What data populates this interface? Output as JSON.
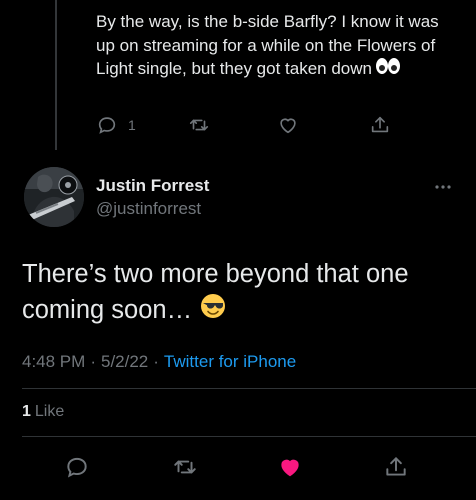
{
  "parent_tweet": {
    "text": "By the way, is the b-side Barfly? I know it was up on streaming for a while on the Flowers of Light single, but they got taken down",
    "trailing_emoji": "eyes-emoji",
    "actions": {
      "reply_icon": "reply-icon",
      "reply_count": "1",
      "retweet_icon": "retweet-icon",
      "like_icon": "heart-outline-icon",
      "share_icon": "share-icon"
    }
  },
  "tweet": {
    "author": {
      "display_name": "Justin Forrest",
      "handle": "@justinforrest",
      "avatar_icon": "avatar"
    },
    "more_icon": "more-options-icon",
    "text": "There’s two more beyond that one coming soon…",
    "trailing_emoji": "smiling-face-with-sunglasses-emoji",
    "time": "4:48 PM",
    "separator": "·",
    "date": "5/2/22",
    "source": "Twitter for iPhone",
    "likes": {
      "count": "1",
      "label": "Like"
    },
    "actions": {
      "reply_icon": "reply-icon",
      "retweet_icon": "retweet-icon",
      "like_icon": "heart-filled-icon",
      "share_icon": "share-icon"
    }
  },
  "colors": {
    "background": "#000000",
    "text_primary": "#e7e9ea",
    "text_secondary": "#71767b",
    "link": "#1d9bf0",
    "like_active": "#f91880",
    "divider": "#2f3336"
  }
}
